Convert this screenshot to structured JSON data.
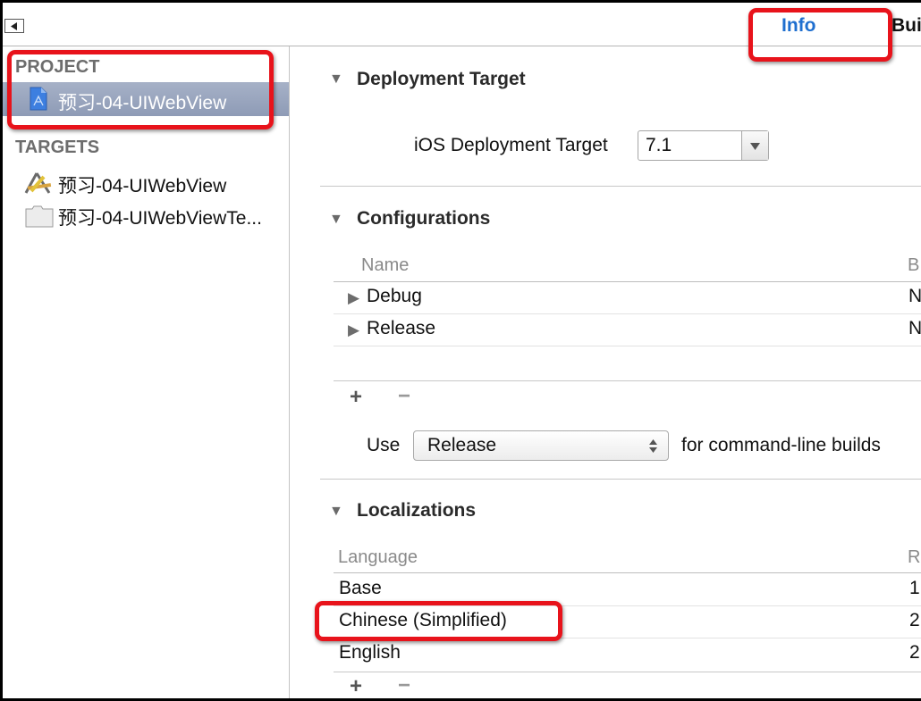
{
  "toolbar": {
    "sidebar_toggle_icon": "triangle-left-icon",
    "tabs": [
      {
        "label": "Info",
        "active": true,
        "color": "#1f6fcf"
      },
      {
        "label": "Bui"
      }
    ]
  },
  "sidebar": {
    "project_header": "PROJECT",
    "project_item": {
      "label": "预习-04-UIWebView",
      "icon": "project-file-icon",
      "selected": true
    },
    "targets_header": "TARGETS",
    "targets": [
      {
        "label": "预习-04-UIWebView",
        "icon": "app-target-icon"
      },
      {
        "label": "预习-04-UIWebViewTe...",
        "icon": "test-bundle-icon"
      }
    ]
  },
  "deployment": {
    "title": "Deployment Target",
    "field_label": "iOS Deployment Target",
    "value": "7.1"
  },
  "configurations": {
    "title": "Configurations",
    "columns": [
      "Name",
      "B"
    ],
    "rows": [
      {
        "name": "Debug",
        "col2": "N"
      },
      {
        "name": "Release",
        "col2": "N"
      }
    ],
    "add_label": "+",
    "remove_label": "−",
    "use_label": "Use",
    "use_value": "Release",
    "use_suffix": "for command-line builds"
  },
  "localizations": {
    "title": "Localizations",
    "columns": [
      "Language",
      "R"
    ],
    "rows": [
      {
        "language": "Base",
        "col2": "1"
      },
      {
        "language": "Chinese (Simplified)",
        "col2": "2"
      },
      {
        "language": "English",
        "col2": "2"
      }
    ],
    "add_label": "+",
    "remove_label": "−"
  },
  "annotation_color": "#e8131b"
}
